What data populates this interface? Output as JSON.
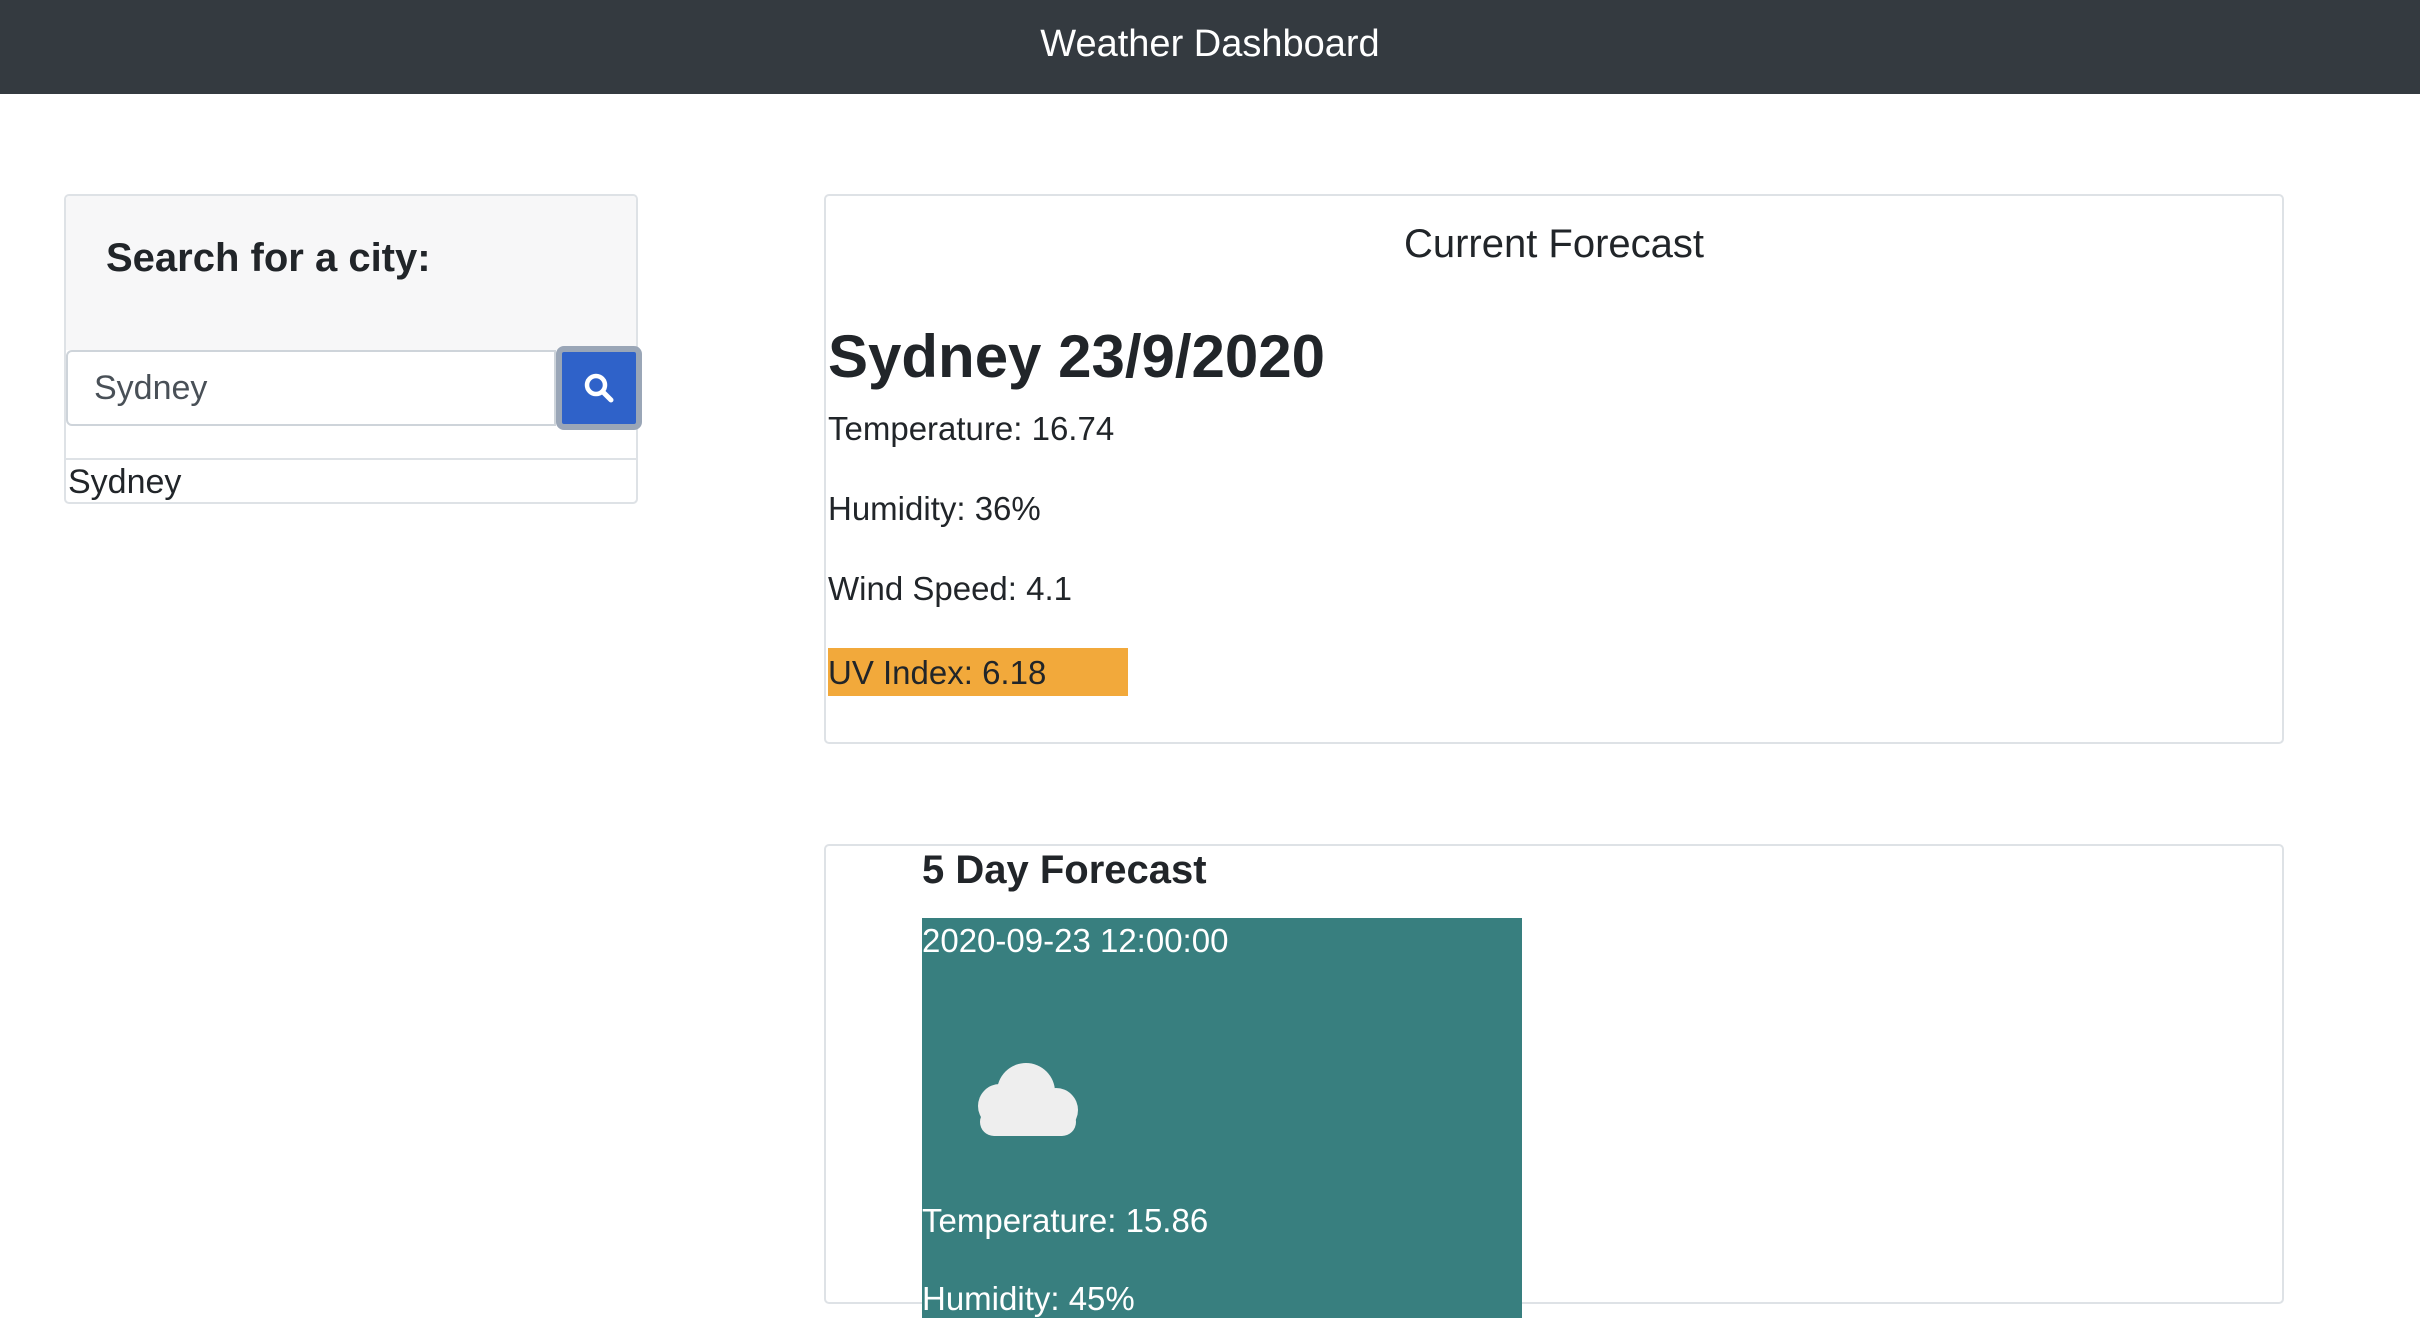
{
  "header": {
    "title": "Weather Dashboard"
  },
  "search": {
    "title": "Search for a city:",
    "input_value": "Sydney",
    "button_icon": "search-icon",
    "history": [
      "Sydney"
    ]
  },
  "current": {
    "header": "Current Forecast",
    "city_date": "Sydney 23/9/2020",
    "temperature": "Temperature: 16.74",
    "humidity": "Humidity: 36%",
    "wind_speed": "Wind Speed: 4.1",
    "uv_index": "UV Index: 6.18",
    "uv_color": "#f2a93b"
  },
  "forecast": {
    "title": "5 Day Forecast",
    "days": [
      {
        "date": "2020-09-23 12:00:00",
        "icon": "cloud-icon",
        "temperature": "Temperature: 15.86",
        "humidity": "Humidity: 45%",
        "color": "#387f7f"
      }
    ]
  },
  "colors": {
    "navbar": "#343a40",
    "search_button": "#2f62c9"
  }
}
